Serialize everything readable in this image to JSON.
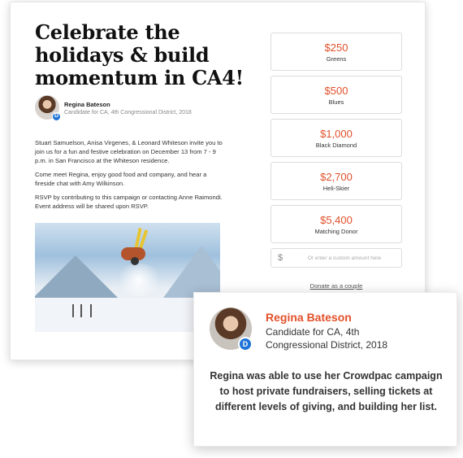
{
  "campaign": {
    "title": "Celebrate the holidays & build momentum in CA4!",
    "author": {
      "name": "Regina Bateson",
      "subtitle": "Candidate for CA, 4th Congressional District, 2018",
      "party_badge": "D"
    },
    "paragraphs": [
      "Stuart Samuelson, Anisa Virgenes, & Leonard Whiteson invite you to join us for a fun and festive celebration on December 13 from 7 - 9 p.m. in San Francisco at the Whiteson residence.",
      "Come meet Regina, enjoy good food and company, and hear a fireside chat with Amy Wilkinson.",
      "RSVP by contributing to this campaign or contacting Anne Raimondi. Event address will be shared upon RSVP."
    ],
    "photo_icon": "skier-photo"
  },
  "donation": {
    "options": [
      {
        "amount": "$250",
        "label": "Greens"
      },
      {
        "amount": "$500",
        "label": "Blues"
      },
      {
        "amount": "$1,000",
        "label": "Black Diamond"
      },
      {
        "amount": "$2,700",
        "label": "Heli-Skier"
      },
      {
        "amount": "$5,400",
        "label": "Matching Donor"
      }
    ],
    "custom_symbol": "$",
    "custom_placeholder": "Or enter a custom amount here",
    "donate_couple_label": "Donate as a couple"
  },
  "testimonial": {
    "name": "Regina Bateson",
    "subtitle": "Candidate for CA, 4th Congressional District, 2018",
    "party_badge": "D",
    "quote": "Regina was able to use her Crowdpac campaign to host private fundraisers, selling tickets at different levels of giving, and building her list."
  },
  "colors": {
    "accent": "#e2502a",
    "badge": "#1e73d6"
  }
}
